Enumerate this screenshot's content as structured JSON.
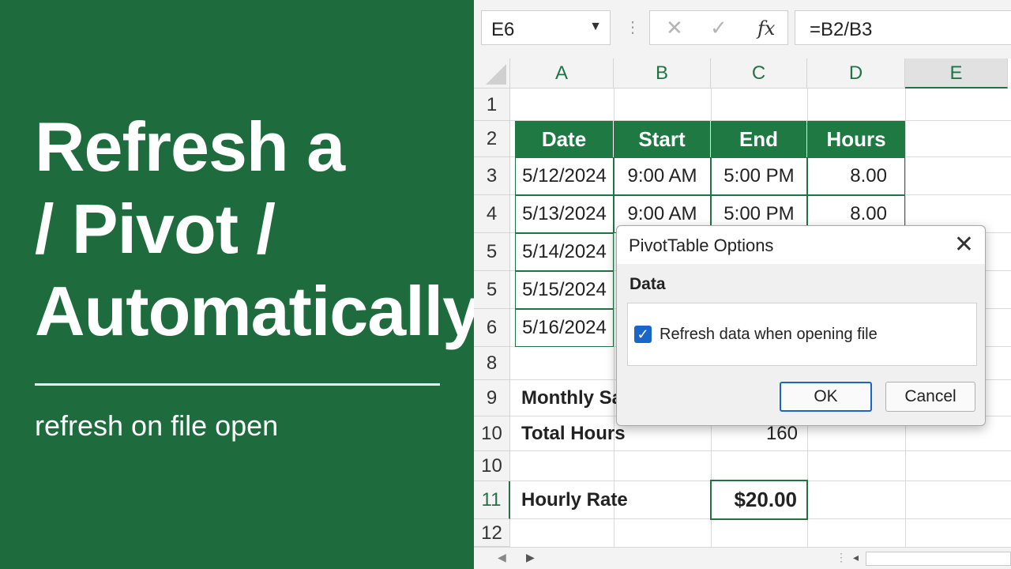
{
  "left_panel": {
    "title_lines": [
      "Refresh a",
      "/ Pivot /",
      "Automatically"
    ],
    "subtitle": "refresh on file open",
    "background_color": "#1e6b3d"
  },
  "formula_bar": {
    "name_box": "E6",
    "dropdown_icon": "chevron-down-icon",
    "dots": "⋮",
    "cancel_glyph": "✕",
    "enter_glyph": "✓",
    "fx_label": "fx",
    "formula": "=B2/B3"
  },
  "grid": {
    "columns": [
      "A",
      "B",
      "C",
      "D",
      "E"
    ],
    "selected_column": "E",
    "rows": [
      "1",
      "2",
      "3",
      "4",
      "5",
      "5",
      "6",
      "8",
      "9",
      "10",
      "10",
      "11",
      "12"
    ],
    "table_header": [
      "Date",
      "Start",
      "End",
      "Hours"
    ],
    "table_rows": [
      {
        "date": "5/12/2024",
        "start": "9:00 AM",
        "end": "5:00 PM",
        "hours": "8.00"
      },
      {
        "date": "5/13/2024",
        "start": "9:00 AM",
        "end": "5:00 PM",
        "hours": "8.00"
      },
      {
        "date": "5/14/2024"
      },
      {
        "date": "5/15/2024"
      },
      {
        "date": "5/16/2024"
      }
    ],
    "monthly_label": "Monthly Sa",
    "total_hours_label": "Total Hours",
    "total_hours_value": "160",
    "hourly_rate_label": "Hourly Rate",
    "hourly_rate_value": "$20.00",
    "accent_color": "#217346"
  },
  "dialog": {
    "title": "PivotTable Options",
    "close_glyph": "✕",
    "section": "Data",
    "checkbox_label": "Refresh data when opening file",
    "checkbox_checked": true,
    "ok_label": "OK",
    "cancel_label": "Cancel"
  },
  "scrollbar": {
    "left_arrow": "◀",
    "right_arrow": "▶",
    "sheet_dots": "⋮",
    "scroll_left": "◂"
  }
}
